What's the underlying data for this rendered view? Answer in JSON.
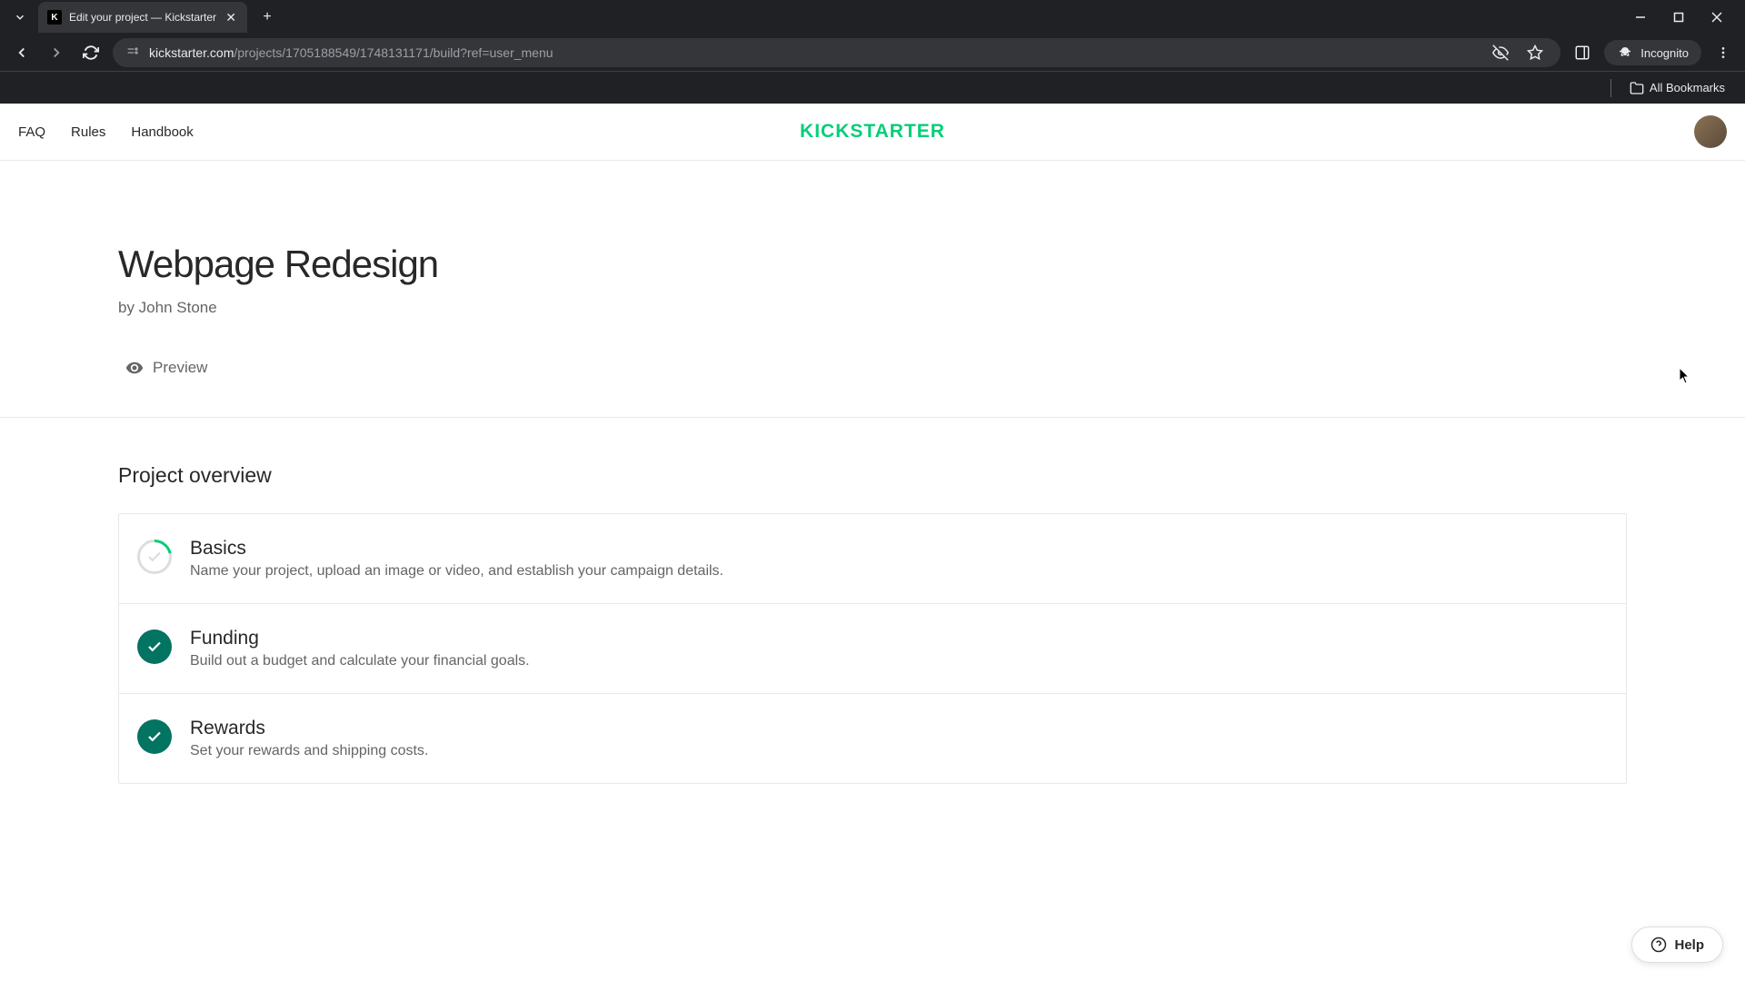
{
  "browser": {
    "tab_title": "Edit your project — Kickstarter",
    "url_domain": "kickstarter.com",
    "url_path": "/projects/1705188549/1748131171/build?ref=user_menu",
    "incognito_label": "Incognito",
    "all_bookmarks_label": "All Bookmarks"
  },
  "header": {
    "nav": [
      "FAQ",
      "Rules",
      "Handbook"
    ],
    "logo_text": "KICKSTARTER"
  },
  "project": {
    "title": "Webpage Redesign",
    "byline": "by John Stone",
    "preview_label": "Preview"
  },
  "overview": {
    "section_title": "Project overview",
    "items": [
      {
        "title": "Basics",
        "desc": "Name your project, upload an image or video, and establish your campaign details.",
        "status": "incomplete"
      },
      {
        "title": "Funding",
        "desc": "Build out a budget and calculate your financial goals.",
        "status": "complete"
      },
      {
        "title": "Rewards",
        "desc": "Set your rewards and shipping costs.",
        "status": "complete"
      }
    ]
  },
  "help": {
    "label": "Help"
  }
}
